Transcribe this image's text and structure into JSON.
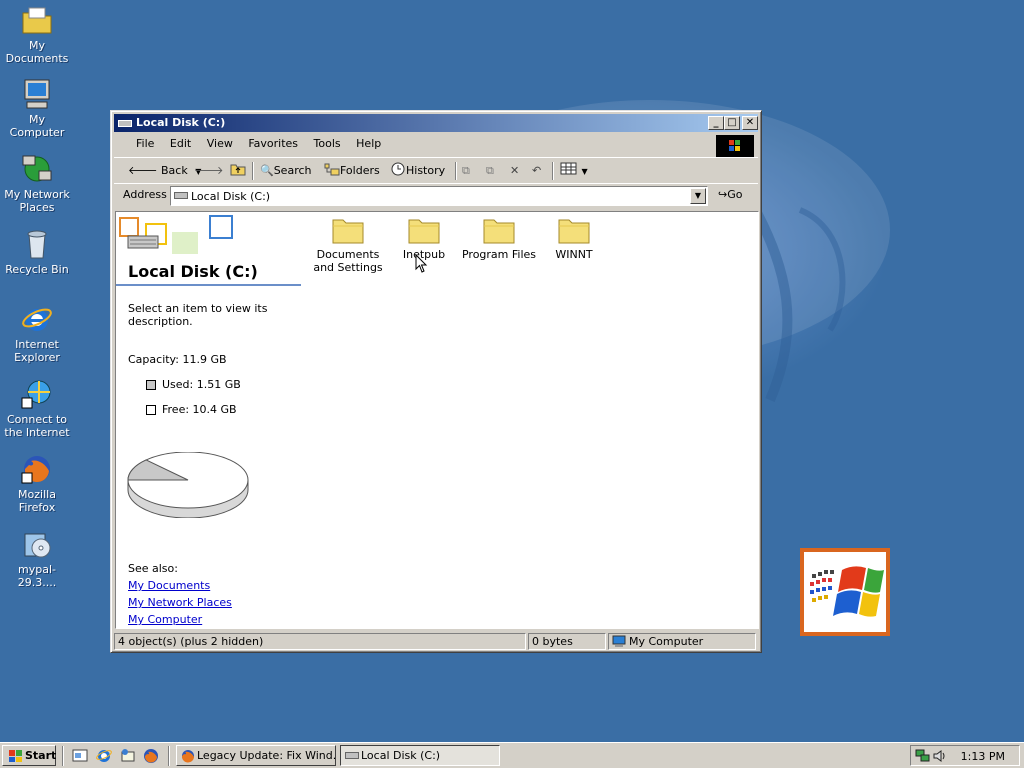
{
  "desktop": {
    "icons": [
      {
        "label": "My Documents",
        "icon": "folder-documents-icon"
      },
      {
        "label": "My Computer",
        "icon": "computer-icon"
      },
      {
        "label": "My Network Places",
        "icon": "network-icon"
      },
      {
        "label": "Recycle Bin",
        "icon": "recycle-bin-icon"
      },
      {
        "label": "Internet Explorer",
        "icon": "ie-icon"
      },
      {
        "label": "Connect to the Internet",
        "icon": "connect-icon"
      },
      {
        "label": "Mozilla Firefox",
        "icon": "firefox-icon"
      },
      {
        "label": "mypal-29.3....",
        "icon": "installer-icon"
      }
    ]
  },
  "window": {
    "title": "Local Disk (C:)",
    "menu": [
      "File",
      "Edit",
      "View",
      "Favorites",
      "Tools",
      "Help"
    ],
    "toolbar": {
      "back": "Back",
      "search": "Search",
      "folders": "Folders",
      "history": "History"
    },
    "address": {
      "label": "Address",
      "value": "Local Disk (C:)",
      "go": "Go"
    },
    "left_pane": {
      "title": "Local Disk (C:)",
      "description": "Select an item to view its description.",
      "capacity": "Capacity: 11.9 GB",
      "used": "Used: 1.51 GB",
      "free": "Free: 10.4 GB",
      "used_fraction": 0.127,
      "see_also": "See also:",
      "links": [
        "My Documents",
        "My Network Places",
        "My Computer"
      ]
    },
    "files": [
      {
        "name": "Documents and Settings"
      },
      {
        "name": "Inetpub"
      },
      {
        "name": "Program Files"
      },
      {
        "name": "WINNT"
      }
    ],
    "status": {
      "objects": "4 object(s) (plus 2 hidden)",
      "size": "0 bytes",
      "zone": "My Computer"
    }
  },
  "taskbar": {
    "start": "Start",
    "tasks": [
      {
        "label": "Legacy Update: Fix Wind...",
        "active": false
      },
      {
        "label": "Local Disk (C:)",
        "active": true
      }
    ],
    "clock": "1:13 PM"
  }
}
